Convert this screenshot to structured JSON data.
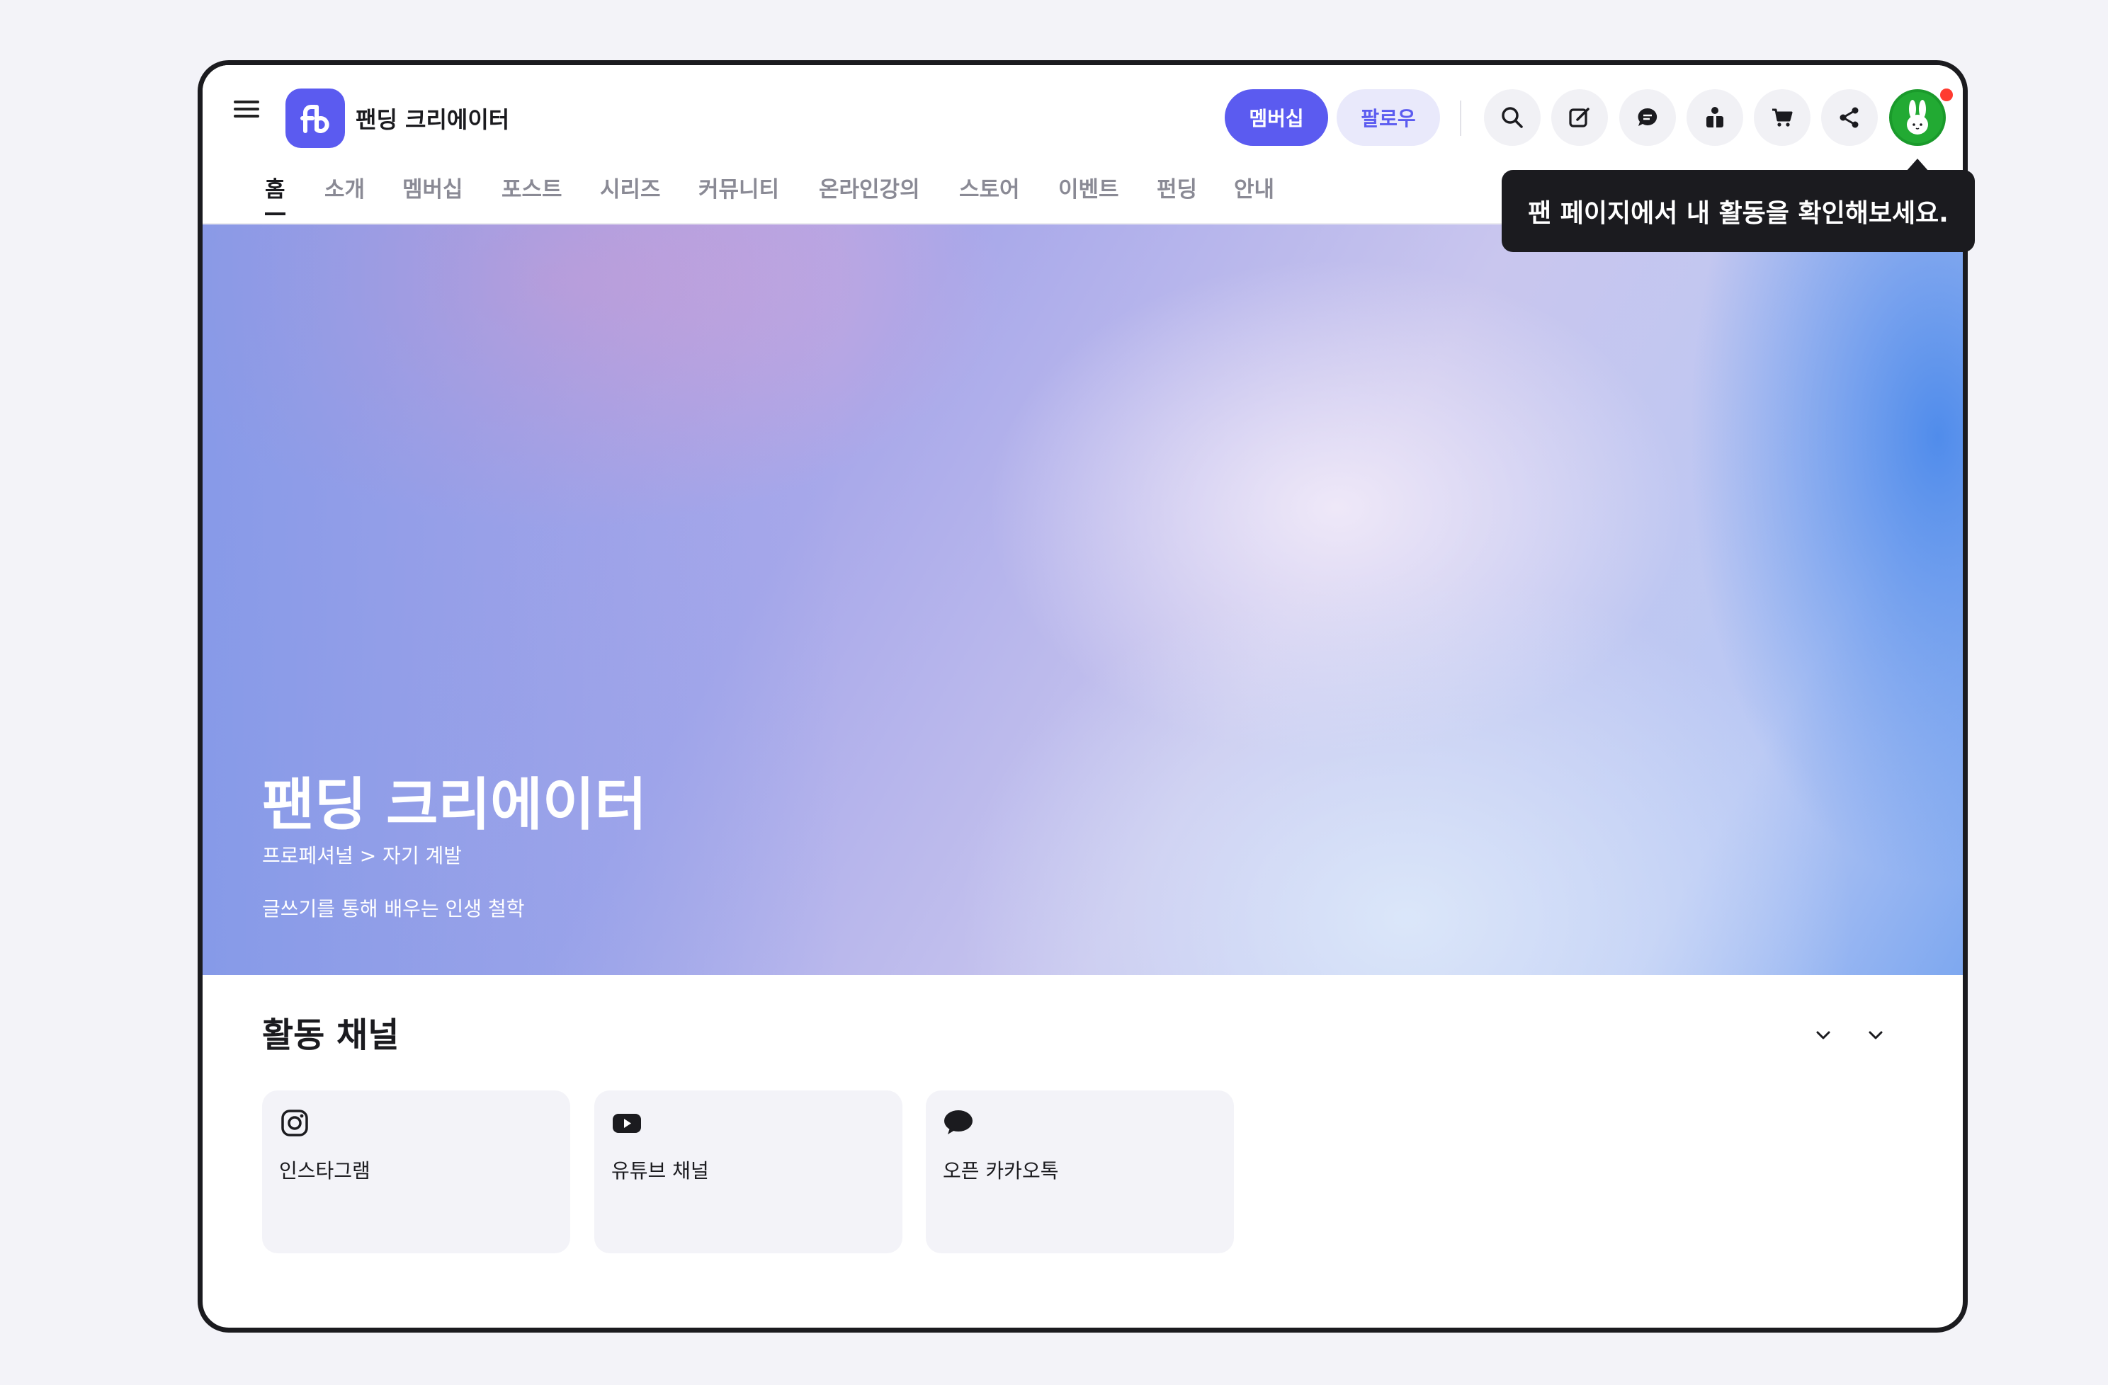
{
  "header": {
    "brand": "팬딩 크리에이터",
    "membership_button": "멤버십",
    "follow_button": "팔로우",
    "icons": [
      "menu-icon",
      "search-icon",
      "edit-icon",
      "chat-icon",
      "gift-icon",
      "cart-icon",
      "share-icon"
    ],
    "avatar": "rabbit-avatar"
  },
  "tabs": [
    {
      "label": "홈",
      "active": true
    },
    {
      "label": "소개"
    },
    {
      "label": "멤버십"
    },
    {
      "label": "포스트"
    },
    {
      "label": "시리즈"
    },
    {
      "label": "커뮤니티"
    },
    {
      "label": "온라인강의"
    },
    {
      "label": "스토어"
    },
    {
      "label": "이벤트"
    },
    {
      "label": "펀딩"
    },
    {
      "label": "안내"
    }
  ],
  "hero": {
    "title": "팬딩 크리에이터",
    "category": "프로페셔널 > 자기 계발",
    "description": "글쓰기를 통해 배우는 인생 철학"
  },
  "activity": {
    "title": "활동 채널",
    "channels": [
      {
        "label": "인스타그램",
        "icon": "instagram-icon"
      },
      {
        "label": "유튜브 채널",
        "icon": "youtube-icon"
      },
      {
        "label": "오픈 카카오톡",
        "icon": "kakaotalk-icon"
      }
    ]
  },
  "tooltip": "팬 페이지에서 내 활동을 확인해보세요.",
  "colors": {
    "accent": "#5b5bf0",
    "avatar_green": "#22aa33",
    "notification": "#ff3b30"
  }
}
